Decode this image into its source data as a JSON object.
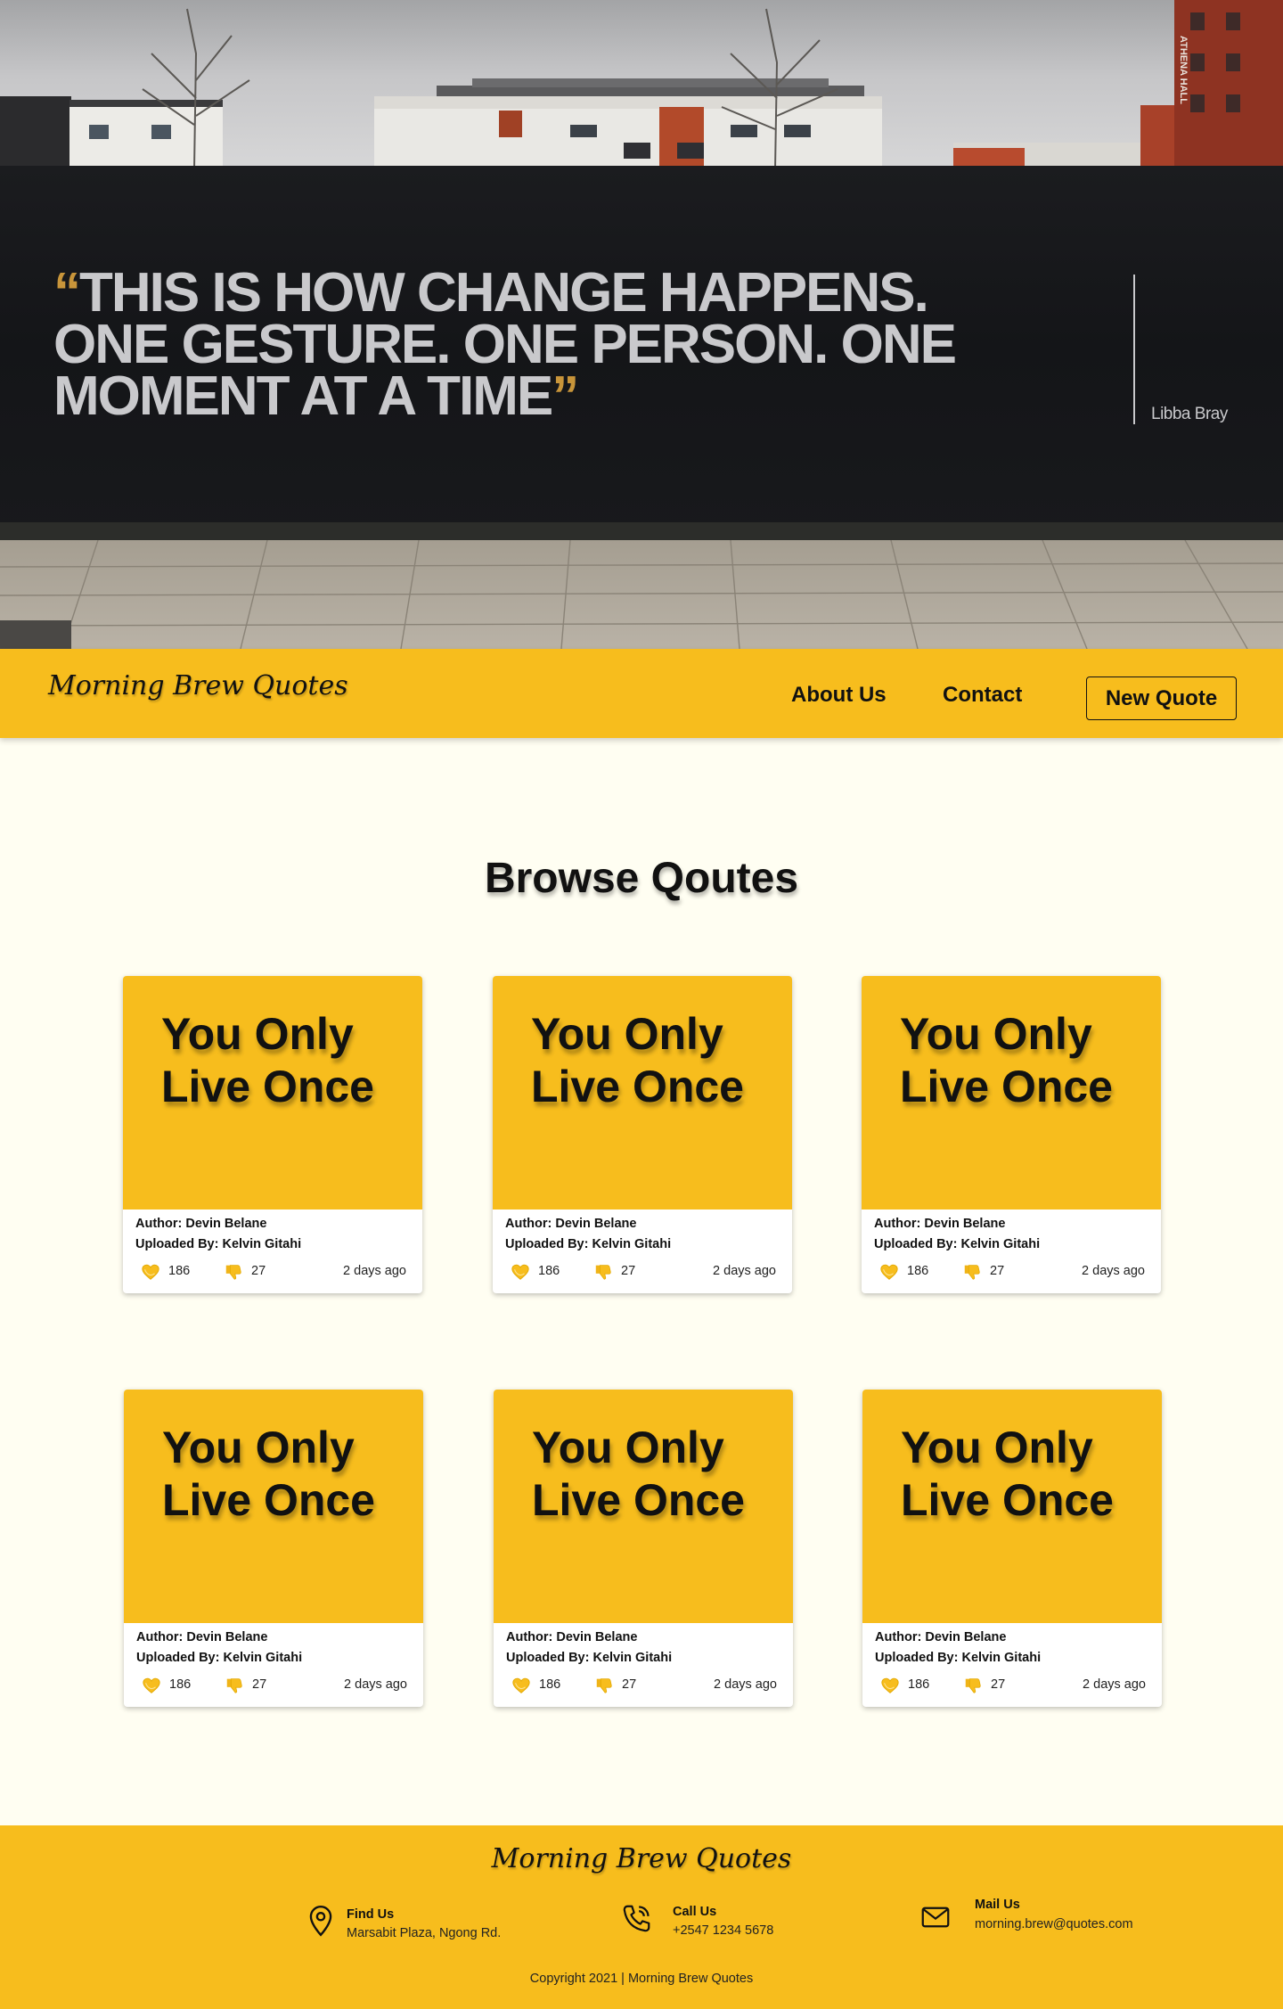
{
  "hero": {
    "quote": "THIS IS HOW CHANGE HAPPENS. ONE GESTURE. ONE PERSON. ONE MOMENT AT A TIME",
    "open_mark": "“",
    "close_mark": "”",
    "author": "Libba Bray",
    "building_sign": "ATHENA HALL"
  },
  "nav": {
    "logo": "Morning Brew Quotes",
    "about": "About Us",
    "contact": "Contact",
    "new_quote": "New Quote"
  },
  "browse": {
    "title": "Browse Qoutes",
    "cards": [
      {
        "quote": "You Only Live Once",
        "author": "Author: Devin Belane",
        "uploader": "Uploaded By: Kelvin Gitahi",
        "likes": "186",
        "dislikes": "27",
        "time": "2 days ago"
      },
      {
        "quote": "You Only Live Once",
        "author": "Author: Devin Belane",
        "uploader": "Uploaded By: Kelvin Gitahi",
        "likes": "186",
        "dislikes": "27",
        "time": "2 days ago"
      },
      {
        "quote": "You Only Live Once",
        "author": "Author: Devin Belane",
        "uploader": "Uploaded By: Kelvin Gitahi",
        "likes": "186",
        "dislikes": "27",
        "time": "2 days ago"
      },
      {
        "quote": "You Only Live Once",
        "author": "Author: Devin Belane",
        "uploader": "Uploaded By: Kelvin Gitahi",
        "likes": "186",
        "dislikes": "27",
        "time": "2 days ago"
      },
      {
        "quote": "You Only Live Once",
        "author": "Author: Devin Belane",
        "uploader": "Uploaded By: Kelvin Gitahi",
        "likes": "186",
        "dislikes": "27",
        "time": "2 days ago"
      },
      {
        "quote": "You Only Live Once",
        "author": "Author: Devin Belane",
        "uploader": "Uploaded By: Kelvin Gitahi",
        "likes": "186",
        "dislikes": "27",
        "time": "2 days ago"
      }
    ]
  },
  "footer": {
    "logo": "Morning Brew Quotes",
    "find_title": "Find Us",
    "find_value": "Marsabit Plaza, Ngong Rd.",
    "call_title": "Call Us",
    "call_value": "+2547 1234 5678",
    "mail_title": "Mail Us",
    "mail_value": "morning.brew@quotes.com",
    "copyright": "Copyright 2021 | Morning Brew Quotes"
  },
  "colors": {
    "accent": "#f7bd1d",
    "background": "#fffef2",
    "text": "#111111",
    "hero_wall": "#17181b",
    "hero_text": "#c9c9cc",
    "quote_mark": "#c8953a"
  },
  "icons": {
    "like": "heart-icon",
    "dislike": "thumbs-down-icon",
    "find": "location-pin-icon",
    "call": "phone-icon",
    "mail": "mail-icon"
  }
}
